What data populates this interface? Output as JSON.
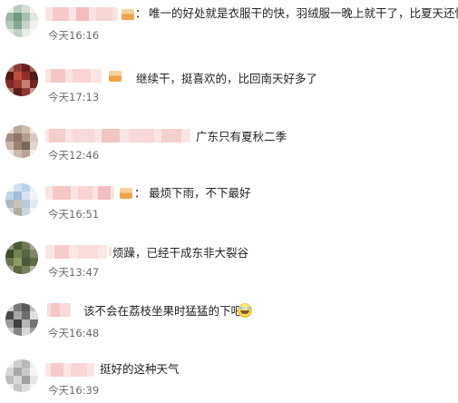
{
  "comments": [
    {
      "text": "唯一的好处就是衣服干的快，羽绒服一晚上就干了，比夏天还快",
      "time": "今天16:16",
      "colon": "："
    },
    {
      "text": "继续干，挺喜欢的，比回南天好多了",
      "time": "今天17:13"
    },
    {
      "text": "广东只有夏秋二季",
      "time": "今天12:46"
    },
    {
      "text": "最烦下雨，不下最好",
      "time": "今天16:51",
      "colon": "："
    },
    {
      "text": "烦躁，已经干成东非大裂谷",
      "time": "今天13:47"
    },
    {
      "text": "该不会在荔枝坐果时猛猛的下吧",
      "time": "今天16:48",
      "emoji": "laugh-cry-emoji"
    },
    {
      "text": "挺好的这种天气",
      "time": "今天16:39"
    }
  ]
}
